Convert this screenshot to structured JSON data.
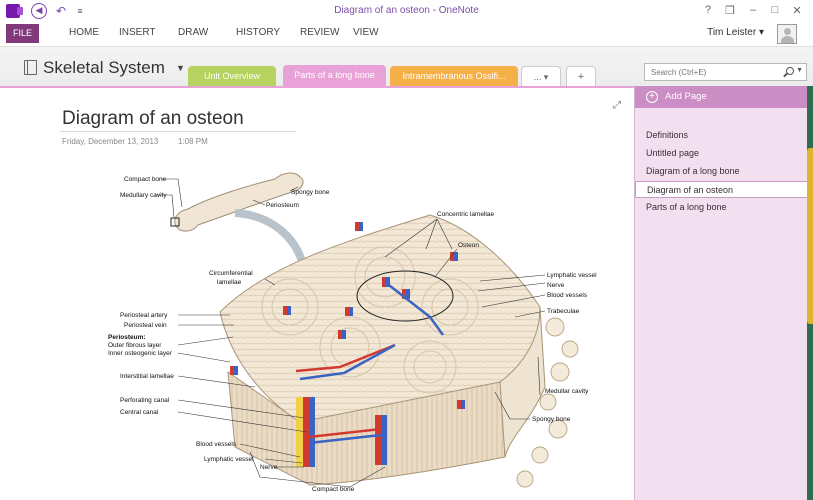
{
  "window": {
    "title": "Diagram of an osteon - OneNote"
  },
  "quick_access": {
    "undo_icon": "undo-icon",
    "back_icon": "back-icon",
    "more": "≡"
  },
  "ribbon": {
    "tabs": [
      "FILE",
      "HOME",
      "INSERT",
      "DRAW",
      "HISTORY",
      "REVIEW",
      "VIEW"
    ],
    "user": "Tim Leister",
    "controls": [
      "?",
      "❒",
      "–",
      "□",
      "✕"
    ]
  },
  "notebook": {
    "name": "Skeletal System",
    "sections": [
      {
        "label": "Unit Overview",
        "color": "#b6d35f"
      },
      {
        "label": "Parts of a long bone",
        "color": "#e8a2d7"
      },
      {
        "label": "Intramembranous Ossifi...",
        "color": "#f5b04a"
      },
      {
        "label": "... ▾"
      },
      {
        "label": "+"
      }
    ]
  },
  "search": {
    "placeholder": "Search (Ctrl+E)"
  },
  "page": {
    "title": "Diagram of an osteon",
    "date": "Friday, December 13, 2013",
    "time": "1:08 PM"
  },
  "diagram_labels": {
    "compact_bone_top": "Compact bone",
    "medullary_cavity": "Medullary cavity",
    "spongy_bone_top": "Spongy bone",
    "periosteum": "Periosteum",
    "concentric_lamellae": "Concentric lamellae",
    "osteon": "Osteon",
    "circumferential": "Circumferential",
    "lamellae": "lamellae",
    "lymphatic_vessel_right": "Lymphatic vessel",
    "nerve_right": "Nerve",
    "blood_vessels_right": "Blood vessels",
    "trabeculae": "Trabeculae",
    "periosteal_artery": "Periosteal artery",
    "periosteal_vein": "Periosteal vein",
    "periosteum_group": "Periosteum:",
    "outer_fibrous": "Outer fibrous layer",
    "inner_osteogenic": "Inner osteogenic layer",
    "interstitial_lamellae": "Interstitial lamellae",
    "perforating_canal": "Perforating canal",
    "central_canal": "Central canal",
    "blood_vessels_bottom": "Blood vessels",
    "lymphatic_vessel_bottom": "Lymphatic vessel",
    "nerve_bottom": "Nerve",
    "compact_bone_bottom": "Compact bone",
    "medullar_cavity": "Medullar cavity",
    "spongy_bone_right": "Spongy bone"
  },
  "page_list": {
    "add_label": "Add Page",
    "items": [
      {
        "label": "Definitions"
      },
      {
        "label": "Untitled page"
      },
      {
        "label": "Diagram of a long bone"
      },
      {
        "label": "Diagram of an osteon",
        "selected": true
      },
      {
        "label": "Parts of a long bone"
      }
    ]
  },
  "colors": {
    "accent": "#80397b",
    "page_list_bg": "#f2e0f0",
    "section_selected": "#e8a2d7"
  }
}
